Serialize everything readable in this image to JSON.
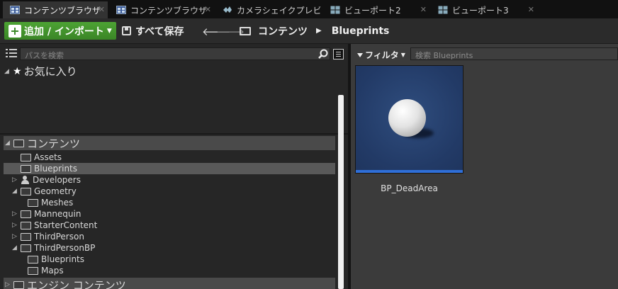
{
  "tabs": [
    {
      "label": "コンテンツブラウザ",
      "active": true,
      "icon": "content-browser-icon"
    },
    {
      "label": "コンテンツブラウザ",
      "active": false,
      "icon": "content-browser-icon"
    },
    {
      "label": "カメラシェイクプレビ",
      "active": false,
      "icon": "camera-shake-icon"
    },
    {
      "label": "ビューポート2",
      "active": false,
      "icon": "viewport-icon"
    },
    {
      "label": "ビューポート3",
      "active": false,
      "icon": "viewport-icon"
    }
  ],
  "toolbar": {
    "add_label": "追加 / インポート",
    "save_label": "すべて保存",
    "back_glyph": "🡐",
    "forward_glyph": "🡒",
    "breadcrumb": [
      "コンテンツ",
      "Blueprints"
    ]
  },
  "left": {
    "search_placeholder": "パスを検索",
    "favorites_label": "お気に入り"
  },
  "tree": [
    {
      "label": "コンテンツ",
      "expand": "open",
      "type": "folder",
      "root": true
    },
    {
      "label": "Assets",
      "expand": "none",
      "type": "folder"
    },
    {
      "label": "Blueprints",
      "expand": "none",
      "type": "folder",
      "selected": true
    },
    {
      "label": "Developers",
      "expand": "closed",
      "type": "person"
    },
    {
      "label": "Geometry",
      "expand": "open",
      "type": "folder"
    },
    {
      "label": "Meshes",
      "expand": "none",
      "type": "folder"
    },
    {
      "label": "Mannequin",
      "expand": "closed",
      "type": "folder"
    },
    {
      "label": "StarterContent",
      "expand": "closed",
      "type": "folder"
    },
    {
      "label": "ThirdPerson",
      "expand": "closed",
      "type": "folder"
    },
    {
      "label": "ThirdPersonBP",
      "expand": "open",
      "type": "folder"
    },
    {
      "label": "Blueprints",
      "expand": "none",
      "type": "folder"
    },
    {
      "label": "Maps",
      "expand": "none",
      "type": "folder"
    },
    {
      "label": "エンジン コンテンツ",
      "expand": "closed",
      "type": "folder",
      "root": true
    }
  ],
  "right": {
    "filter_label": "フィルタ",
    "search_placeholder": "検索 Blueprints",
    "assets": [
      {
        "name": "BP_DeadArea",
        "accent": "#2f6fd8"
      }
    ]
  }
}
